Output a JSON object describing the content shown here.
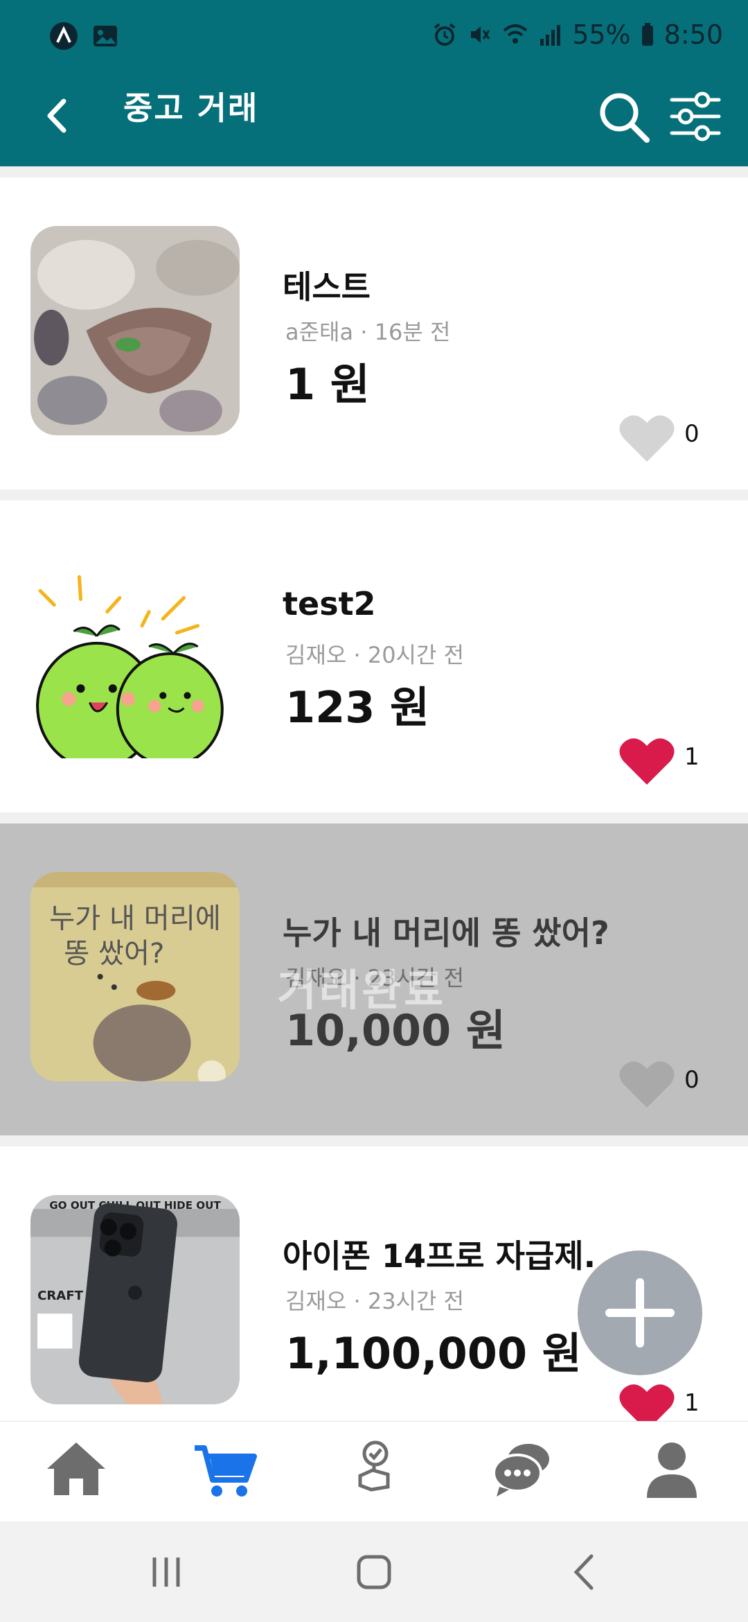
{
  "status": {
    "battery": "55%",
    "time": "8:50"
  },
  "header": {
    "title": "중고 거래"
  },
  "items": [
    {
      "title": "테스트",
      "meta": "a준태a · 16분 전",
      "price": "1 원",
      "likes": "0",
      "liked": false,
      "sold": false
    },
    {
      "title": "test2",
      "meta": "김재오 · 20시간 전",
      "price": "123 원",
      "likes": "1",
      "liked": true,
      "sold": false
    },
    {
      "title": "누가 내 머리에 똥 쌌어?",
      "meta": "김재오 · 23시간 전",
      "price": "10,000 원",
      "likes": "0",
      "liked": false,
      "sold": true,
      "sold_label": "거래완료",
      "thumb_text_line1": "누가 내 머리에",
      "thumb_text_line2": "똥 쌌어?"
    },
    {
      "title": "아이폰 14프로 자급제.",
      "meta": "김재오 · 23시간 전",
      "price": "1,100,000 원",
      "likes": "1",
      "liked": true,
      "sold": false,
      "thumb_text_line1": "GO OUT CHILL OUT HIDE OUT",
      "thumb_text_line2": "CRAFT"
    }
  ],
  "colors": {
    "appbar": "#06707a",
    "heart_liked": "#d81b4a",
    "heart_unliked": "#d4d4d4",
    "nav_active": "#1a73e8",
    "fab": "#a3a9b0"
  },
  "bottom_nav": [
    {
      "icon": "home-icon",
      "active": false
    },
    {
      "icon": "cart-icon",
      "active": true
    },
    {
      "icon": "auction-icon",
      "active": false
    },
    {
      "icon": "chat-icon",
      "active": false
    },
    {
      "icon": "profile-icon",
      "active": false
    }
  ]
}
